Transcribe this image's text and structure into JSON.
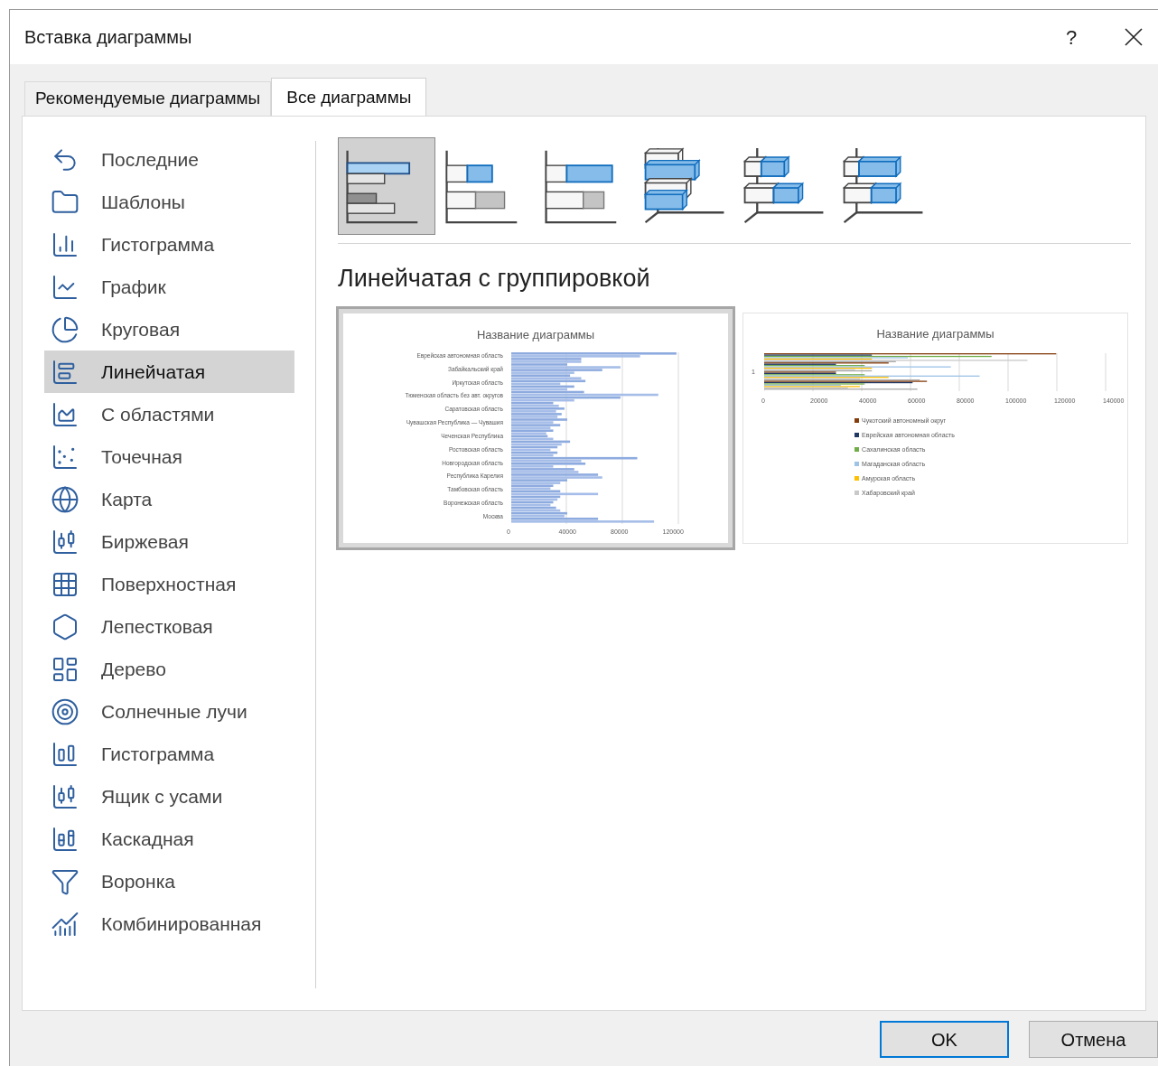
{
  "window": {
    "title": "Вставка диаграммы",
    "help": "?"
  },
  "tabs": [
    {
      "label": "Рекомендуемые диаграммы",
      "selected": false
    },
    {
      "label": "Все диаграммы",
      "selected": true
    }
  ],
  "categories": [
    {
      "label": "Последние",
      "kind": "recent",
      "selected": false
    },
    {
      "label": "Шаблоны",
      "kind": "templates",
      "selected": false
    },
    {
      "label": "Гистограмма",
      "kind": "column",
      "selected": false
    },
    {
      "label": "График",
      "kind": "line",
      "selected": false
    },
    {
      "label": "Круговая",
      "kind": "pie",
      "selected": false
    },
    {
      "label": "Линейчатая",
      "kind": "bar",
      "selected": true
    },
    {
      "label": "С областями",
      "kind": "area",
      "selected": false
    },
    {
      "label": "Точечная",
      "kind": "scatter",
      "selected": false
    },
    {
      "label": "Карта",
      "kind": "map",
      "selected": false
    },
    {
      "label": "Биржевая",
      "kind": "stock",
      "selected": false
    },
    {
      "label": "Поверхностная",
      "kind": "surface",
      "selected": false
    },
    {
      "label": "Лепестковая",
      "kind": "radar",
      "selected": false
    },
    {
      "label": "Дерево",
      "kind": "treemap",
      "selected": false
    },
    {
      "label": "Солнечные лучи",
      "kind": "sunburst",
      "selected": false
    },
    {
      "label": "Гистограмма",
      "kind": "histogram",
      "selected": false
    },
    {
      "label": "Ящик с усами",
      "kind": "boxwhisker",
      "selected": false
    },
    {
      "label": "Каскадная",
      "kind": "waterfall",
      "selected": false
    },
    {
      "label": "Воронка",
      "kind": "funnel",
      "selected": false
    },
    {
      "label": "Комбинированная",
      "kind": "combo",
      "selected": false
    }
  ],
  "subtypes": [
    {
      "kind": "clustered",
      "selected": true
    },
    {
      "kind": "stacked",
      "selected": false
    },
    {
      "kind": "stacked100",
      "selected": false
    },
    {
      "kind": "clustered3d",
      "selected": false
    },
    {
      "kind": "stacked3d",
      "selected": false
    },
    {
      "kind": "stacked100_3d",
      "selected": false
    }
  ],
  "subtype_title": "Линейчатая с группировкой",
  "previews": [
    {
      "kind": "by_region",
      "selected": true,
      "title": "Название диаграммы",
      "labels": [
        "Еврейская автономная область",
        "Забайкальский край",
        "Иркутская область",
        "Тюменская область без авт. округов",
        "Саратовская область",
        "Чувашская Республика — Чувашия",
        "Чеченская Республика",
        "Ростовская область",
        "Новгородская область",
        "Республика Карелия",
        "Тамбовская область",
        "Воронежская область",
        "Москва"
      ],
      "ticks": [
        "0",
        "40000",
        "80000",
        "120000"
      ]
    },
    {
      "kind": "by_series",
      "selected": false,
      "title": "Название диаграммы",
      "axis_label": "1",
      "ticks": [
        "0",
        "20000",
        "40000",
        "60000",
        "80000",
        "100000",
        "120000",
        "140000"
      ],
      "legend": [
        {
          "label": "Чукотский автономный округ",
          "color": "#843c0c"
        },
        {
          "label": "Еврейская автономная область",
          "color": "#1f3864"
        },
        {
          "label": "Сахалинская область",
          "color": "#70ad47"
        },
        {
          "label": "Магаданская область",
          "color": "#9dc3e6"
        },
        {
          "label": "Амурская область",
          "color": "#ffc000"
        },
        {
          "label": "Хабаровский край",
          "color": "#c9c9c9"
        }
      ]
    }
  ],
  "buttons": [
    {
      "label": "OK",
      "default": true
    },
    {
      "label": "Отмена",
      "default": false
    }
  ]
}
